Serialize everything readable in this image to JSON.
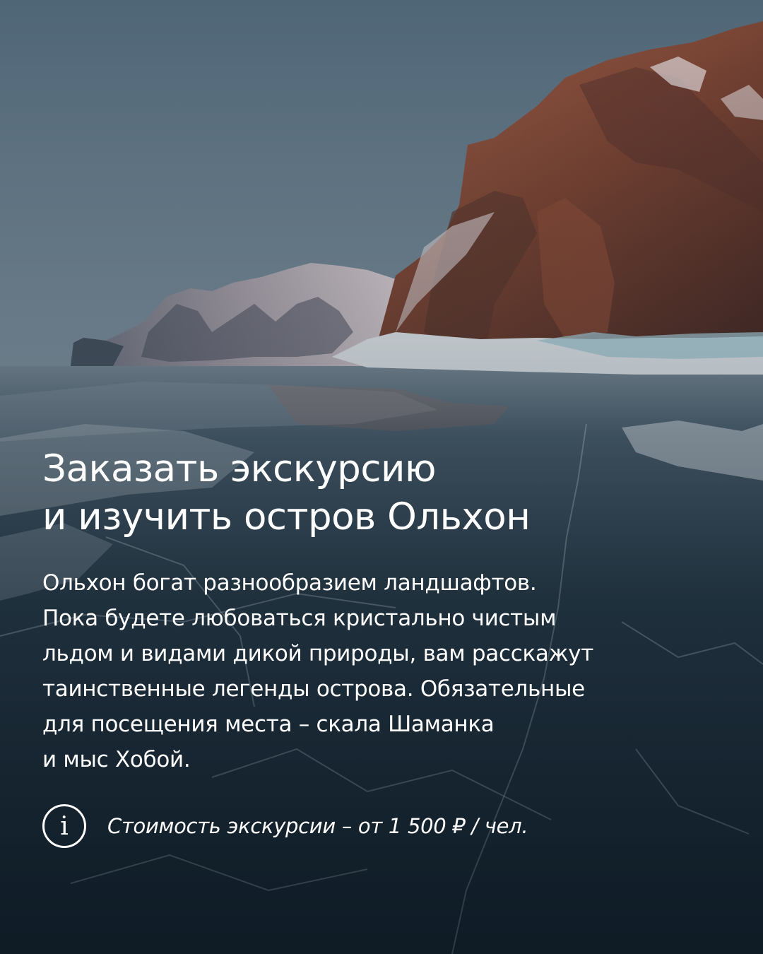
{
  "headline": {
    "line1": "Заказать экскурсию",
    "line2": "и изучить остров Ольхон"
  },
  "body": {
    "lines": [
      "Ольхон богат разнообразием ландшафтов.",
      "Пока будете любоваться кристально чистым",
      "льдом и видами дикой природы, вам расскажут",
      "таинственные легенды острова. Обязательные",
      "для посещения места – скала Шаманка",
      "и мыс Хобой."
    ]
  },
  "price": {
    "icon": "info-icon",
    "icon_glyph": "i",
    "text": "Стоимость экскурсии – от 1 500 ₽ / чел."
  },
  "colors": {
    "text": "#ffffff",
    "sky_top": "#4f6677",
    "ice_dark": "#13222d"
  }
}
